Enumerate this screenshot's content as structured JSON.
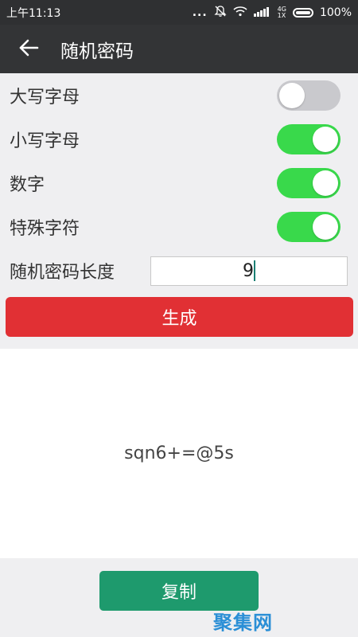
{
  "status_bar": {
    "time": "上午11:13",
    "dots": "...",
    "network": [
      "4G",
      "1X"
    ],
    "battery": "100%",
    "icons": [
      "mute-icon",
      "wifi-icon",
      "signal-icon",
      "battery-icon"
    ]
  },
  "app_bar": {
    "back_icon": "back-arrow-icon",
    "title": "随机密码"
  },
  "options": [
    {
      "label": "大写字母",
      "enabled": false
    },
    {
      "label": "小写字母",
      "enabled": true
    },
    {
      "label": "数字",
      "enabled": true
    },
    {
      "label": "特殊字符",
      "enabled": true
    }
  ],
  "length": {
    "label": "随机密码长度",
    "value": "9"
  },
  "generate_button": {
    "label": "生成"
  },
  "result": {
    "password": "sqn6+=@5s"
  },
  "copy_button": {
    "label": "复制"
  },
  "watermark": "聚集网",
  "colors": {
    "toggle_on": "#39d94b",
    "toggle_off": "#c9c9cd",
    "generate": "#e13034",
    "copy": "#1e9a6d",
    "app_bar": "#333436"
  }
}
